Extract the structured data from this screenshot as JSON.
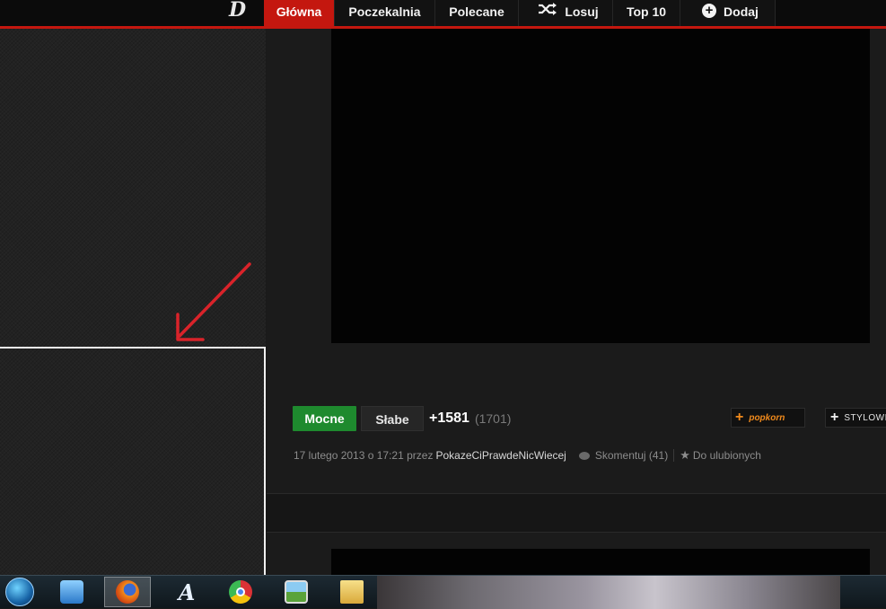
{
  "nav": {
    "items": [
      {
        "label": "Główna",
        "active": true
      },
      {
        "label": "Poczekalnia",
        "active": false
      },
      {
        "label": "Polecane",
        "active": false
      },
      {
        "label": "Losuj",
        "icon": "shuffle-icon",
        "active": false
      },
      {
        "label": "Top 10",
        "active": false
      },
      {
        "label": "Dodaj",
        "icon": "plus-circle-icon",
        "active": false
      }
    ]
  },
  "post": {
    "vote_up_label": "Mocne",
    "vote_down_label": "Słabe",
    "score": "+1581",
    "votes_count": "(1701)",
    "share_popkorn": "popkorn",
    "share_stylowi": "STYLOWI",
    "date_text": "17 lutego 2013 o 17:21 przez",
    "author": "PokazeCiPrawdeNicWiecej",
    "comment_label": "Skomentuj (41)",
    "favorite_label": "Do ulubionych"
  },
  "colors": {
    "accent_red": "#c4170f",
    "vote_green": "#1e8a2e",
    "popkorn_orange": "#f08a1c",
    "annotation_red": "#d9232a",
    "highlight_box": "#f0f0f0"
  },
  "taskbar": {
    "apps": [
      "start-orb-icon",
      "media-player-icon",
      "firefox-icon",
      "text-editor-icon",
      "chrome-icon",
      "picture-viewer-icon",
      "folder-icon"
    ]
  }
}
